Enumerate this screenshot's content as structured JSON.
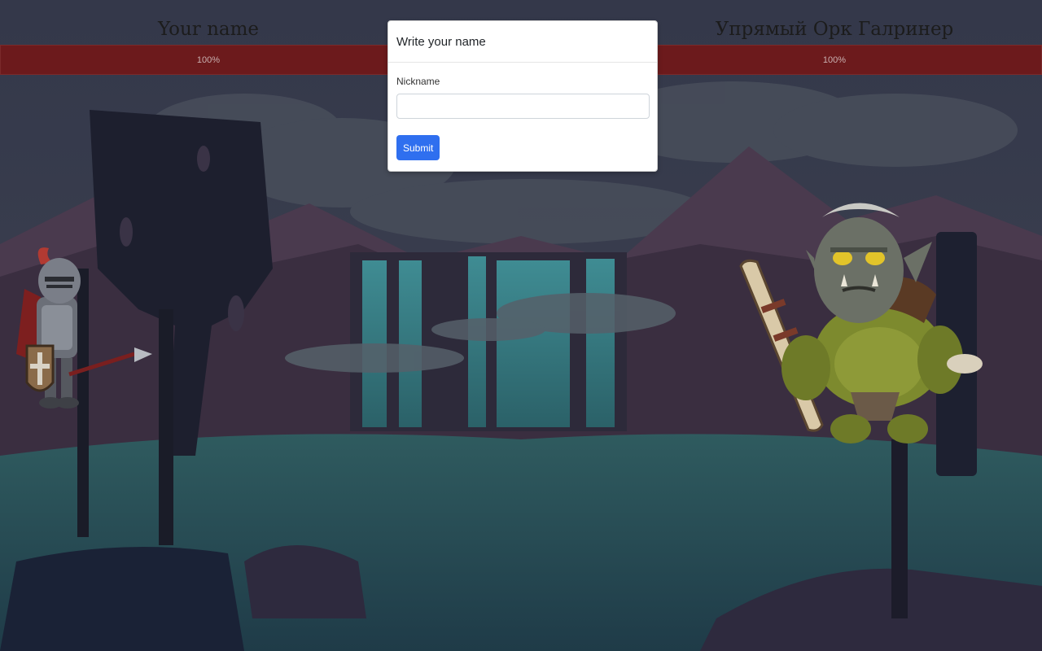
{
  "players": {
    "left": {
      "name": "Your name",
      "health_percent": 100,
      "health_label": "100%"
    },
    "right": {
      "name": "Упрямый Орк Галринер",
      "health_percent": 100,
      "health_label": "100%"
    }
  },
  "modal": {
    "title": "Write your name",
    "field_label": "Nickname",
    "input_value": "",
    "input_placeholder": "",
    "submit_label": "Submit"
  },
  "characters": {
    "player_sprite": "knight-icon",
    "enemy_sprite": "orc-icon"
  },
  "colors": {
    "health_bar": "#6c1a1c",
    "submit_button": "#2f6fef",
    "sky": "#3a3f4c",
    "lake": "#2e5a5c"
  }
}
